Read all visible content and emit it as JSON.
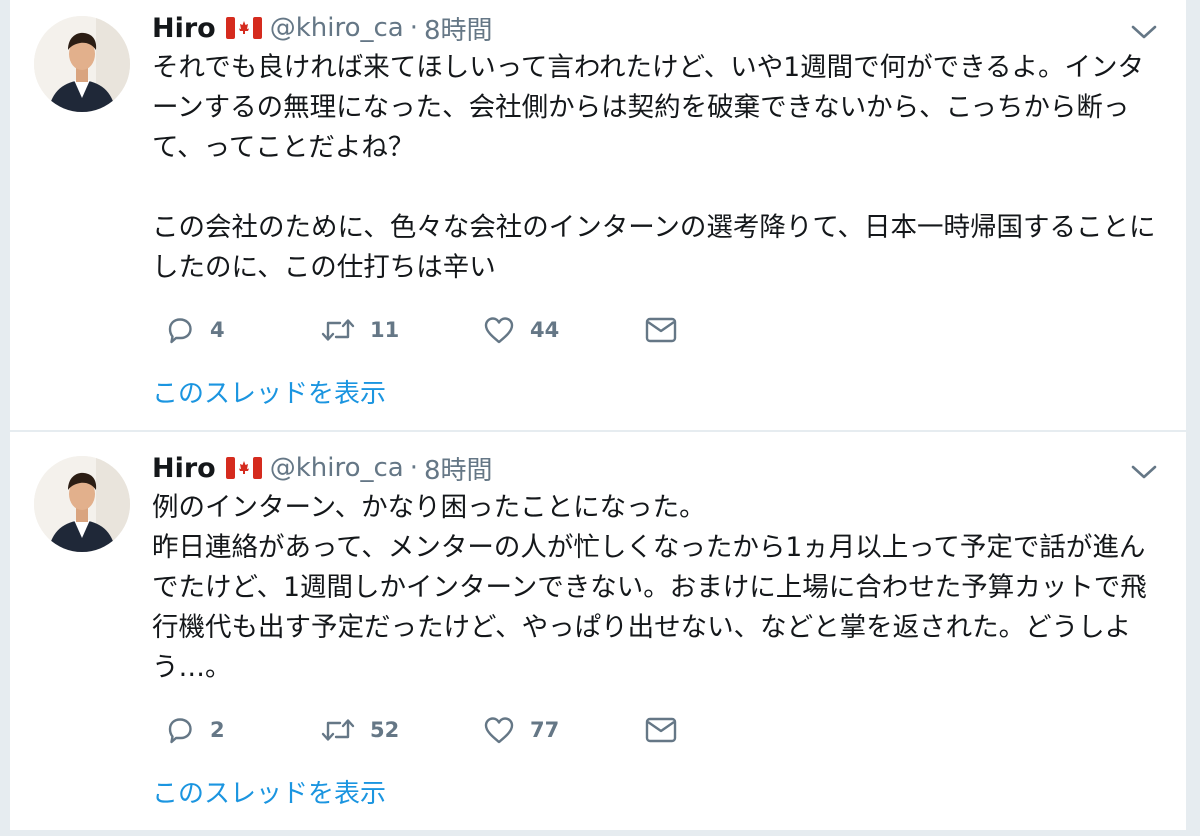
{
  "colors": {
    "text": "#14171a",
    "secondary": "#657786",
    "link": "#1b95e0",
    "divider": "#e6ecf0",
    "flag_red": "#d52b1e"
  },
  "icons": {
    "reply": "reply-icon",
    "retweet": "retweet-icon",
    "like": "heart-icon",
    "dm": "envelope-icon",
    "menu": "chevron-down-icon",
    "flag": "canada-flag-icon"
  },
  "tweets": [
    {
      "name": "Hiro",
      "handle": "@khiro_ca",
      "separator": "·",
      "time": "8時間",
      "text": "それでも良ければ来てほしいって言われたけど、いや1週間で何ができるよ。インターンするの無理になった、会社側からは契約を破棄できないから、こっちから断って、ってことだよね？\n\nこの会社のために、色々な会社のインターンの選考降りて、日本一時帰国することにしたのに、この仕打ちは辛い",
      "reply_count": "4",
      "retweet_count": "11",
      "like_count": "44",
      "thread_label": "このスレッドを表示"
    },
    {
      "name": "Hiro",
      "handle": "@khiro_ca",
      "separator": "·",
      "time": "8時間",
      "text": "例のインターン、かなり困ったことになった。\n昨日連絡があって、メンターの人が忙しくなったから1ヵ月以上って予定で話が進んでたけど、1週間しかインターンできない。おまけに上場に合わせた予算カットで飛行機代も出す予定だったけど、やっぱり出せない、などと掌を返された。どうしよう…。",
      "reply_count": "2",
      "retweet_count": "52",
      "like_count": "77",
      "thread_label": "このスレッドを表示"
    }
  ]
}
